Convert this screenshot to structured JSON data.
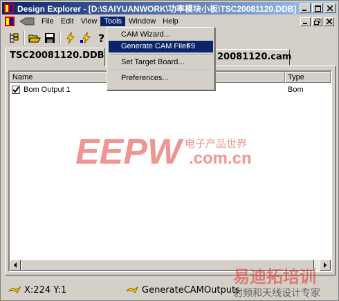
{
  "window": {
    "title": "Design Explorer - [D:\\SAIYUANWORK\\功率模块小板\\TSC20081120.DDB]"
  },
  "menu": {
    "items": [
      {
        "label": "File"
      },
      {
        "label": "Edit"
      },
      {
        "label": "View"
      },
      {
        "label": "Tools"
      },
      {
        "label": "Window"
      },
      {
        "label": "Help"
      }
    ],
    "active": "Tools"
  },
  "tools_menu": {
    "items": [
      {
        "label": "CAM Wizard..."
      },
      {
        "label": "Generate CAM Files",
        "shortcut": "F9"
      },
      {
        "label": "Set Target Board..."
      },
      {
        "label": "Preferences..."
      }
    ],
    "highlighted": "Generate CAM Files"
  },
  "tabs": [
    {
      "label": "TSC20081120.DDB"
    },
    {
      "label": "20081120.cam"
    }
  ],
  "list": {
    "columns": [
      {
        "label": "Name"
      },
      {
        "label": "Type"
      }
    ],
    "rows": [
      {
        "name": "Bom Output 1",
        "type": "Bom",
        "checked": true
      }
    ]
  },
  "status": {
    "coords": "X:224 Y:1",
    "process": "GenerateCAMOutputs"
  },
  "watermark": {
    "logo": "EEPW",
    "tagline_cn": "电子产品世界",
    "domain": ".com.cn",
    "corner_cn": "易迪拓培训",
    "corner_sub": "射频和天线设计专家"
  },
  "colors": {
    "titlebar_start": "#0a246a",
    "titlebar_end": "#a6caf0",
    "highlight": "#0a246a",
    "face": "#d4d0c8",
    "watermark_red": "#e0403c"
  }
}
